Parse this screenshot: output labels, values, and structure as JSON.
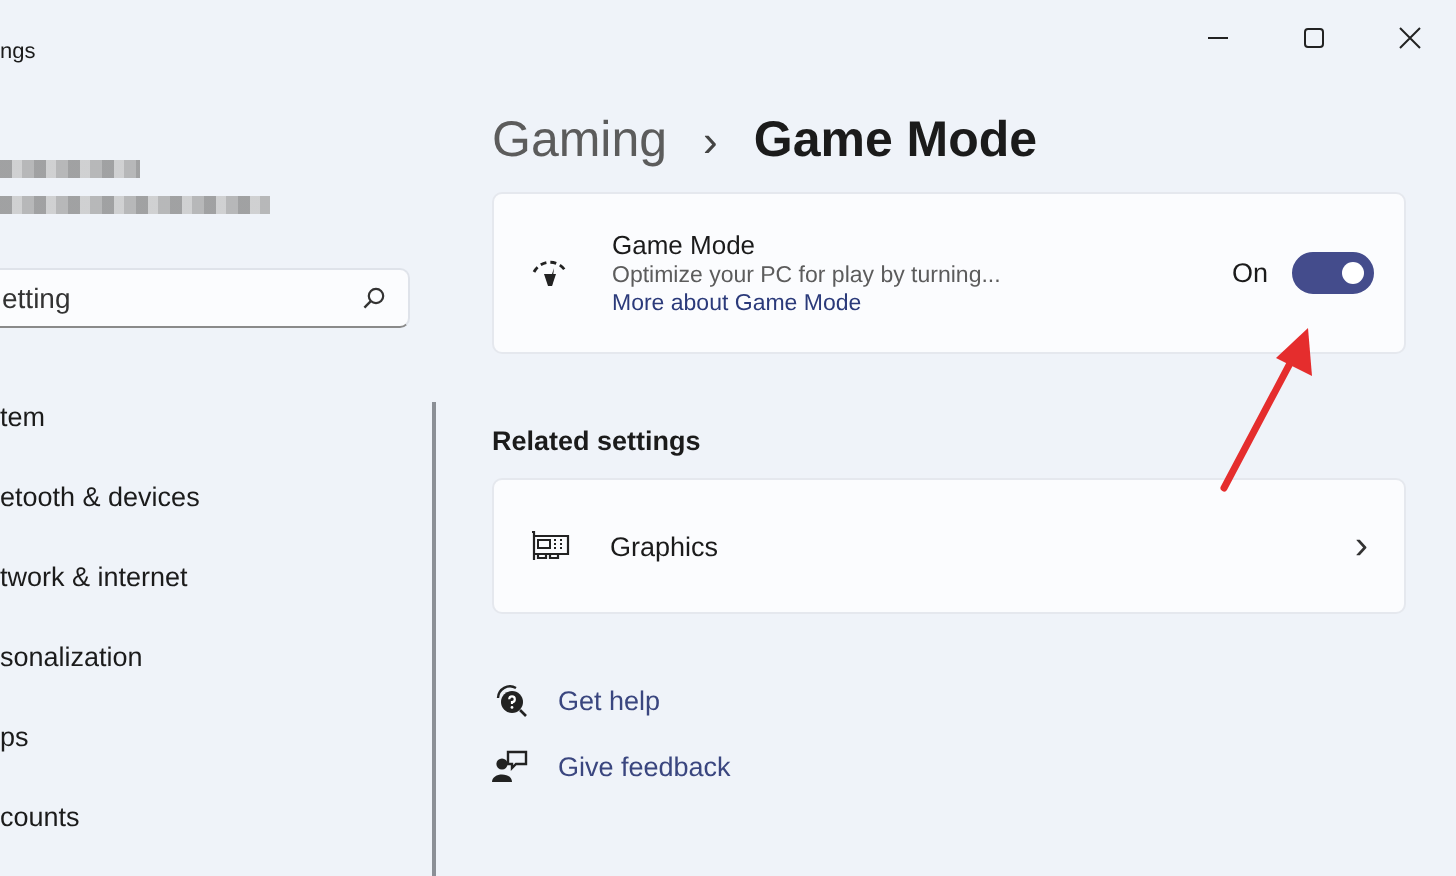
{
  "window": {
    "title": "ngs"
  },
  "search": {
    "placeholder": "etting"
  },
  "sidebar": {
    "items": [
      {
        "label": "tem",
        "selected": false
      },
      {
        "label": "etooth & devices",
        "selected": false
      },
      {
        "label": "twork & internet",
        "selected": false
      },
      {
        "label": "sonalization",
        "selected": false
      },
      {
        "label": "ps",
        "selected": false
      },
      {
        "label": "counts",
        "selected": false
      }
    ]
  },
  "breadcrumb": {
    "parent": "Gaming",
    "separator": "›",
    "current": "Game Mode"
  },
  "game_mode": {
    "title": "Game Mode",
    "description": "Optimize your PC for play by turning...",
    "link": "More about Game Mode",
    "state_label": "On",
    "on": true
  },
  "related_settings": {
    "heading": "Related settings",
    "items": [
      {
        "label": "Graphics",
        "chevron": "›"
      }
    ]
  },
  "help_links": [
    {
      "kind": "help",
      "label": "Get help"
    },
    {
      "kind": "feedback",
      "label": "Give feedback"
    }
  ]
}
